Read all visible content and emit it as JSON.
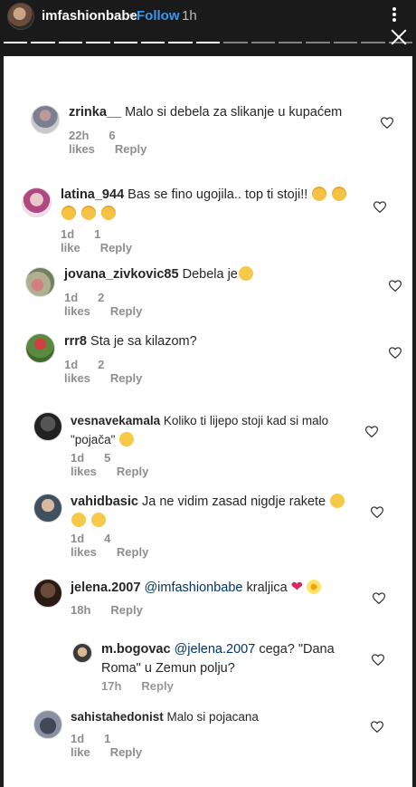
{
  "story": {
    "username": "imfashionbabe",
    "separator": "•",
    "follow_label": "Follow",
    "time": "1h",
    "progress_segments": 15,
    "progress_done": 8
  },
  "comments": [
    {
      "user": "zrinka__",
      "text": "Malo si debela za slikanje u kupaćem",
      "time": "22h",
      "likes": "6 likes",
      "reply": "Reply"
    },
    {
      "user": "latina_944",
      "text": "Bas se fino ugojila.. top ti stoji!!",
      "time": "1d",
      "likes": "1 like",
      "reply": "Reply",
      "emoji": [
        "cat-face",
        "cat-face",
        "heart-eyes-cat",
        "heart-eyes-cat",
        "heart-eyes-cat"
      ]
    },
    {
      "user": "jovana_zivkovic85",
      "text": "Debela je",
      "time": "1d",
      "likes": "2 likes",
      "reply": "Reply",
      "emoji": [
        "smirk"
      ]
    },
    {
      "user": "rrr8",
      "text": "Sta je sa kilazom?",
      "time": "1d",
      "likes": "2 likes",
      "reply": "Reply"
    },
    {
      "user": "vesnavekamala",
      "text": "Koliko ti lijepo stoji kad si malo \"pojača\"",
      "time": "1d",
      "likes": "5 likes",
      "reply": "Reply",
      "emoji": [
        "smirk"
      ]
    },
    {
      "user": "vahidbasic",
      "text": "Ja ne vidim zasad nigdje rakete",
      "time": "1d",
      "likes": "4 likes",
      "reply": "Reply",
      "emoji": [
        "smile",
        "smile",
        "smile"
      ]
    },
    {
      "user": "jelena.2007",
      "mention": "@imfashionbabe",
      "text": "kraljica",
      "time": "18h",
      "reply": "Reply",
      "emoji": [
        "red-heart",
        "blossom"
      ]
    },
    {
      "user": "m.bogovac",
      "mention": "@jelena.2007",
      "text": "cega? \"Dana Roma\" u Zemun polju?",
      "time": "17h",
      "reply": "Reply"
    },
    {
      "user": "sahistahedonist",
      "text": "Malo si pojacana",
      "time": "1d",
      "likes": "1 like",
      "reply": "Reply"
    }
  ]
}
